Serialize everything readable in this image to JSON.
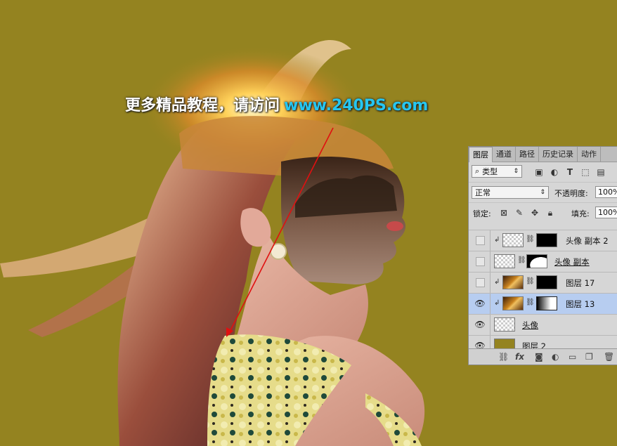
{
  "watermark": {
    "cn": "更多精品教程，请访问",
    "url": "www.240PS.com"
  },
  "panel": {
    "tabs": [
      "图层",
      "通道",
      "路径",
      "历史记录",
      "动作"
    ],
    "filter_label": "类型",
    "blend_mode": "正常",
    "opacity_label": "不透明度:",
    "opacity_value": "100%",
    "lock_label": "锁定:",
    "fill_label": "填充:",
    "fill_value": "100%",
    "layers": [
      {
        "name": "头像 副本 2",
        "visible": false
      },
      {
        "name": "头像 副本",
        "visible": false
      },
      {
        "name": "图层 17",
        "visible": false
      },
      {
        "name": "图层 13",
        "visible": true,
        "selected": true
      },
      {
        "name": "头像",
        "visible": true
      },
      {
        "name": "图层 2",
        "visible": true
      }
    ],
    "footer_icons": [
      "link-icon",
      "fx-icon",
      "mask-icon",
      "adjustment-icon",
      "folder-icon",
      "new-layer-icon",
      "trash-icon"
    ]
  },
  "colors": {
    "background": "#948320",
    "watermark_url": "#26c6f0",
    "arrow": "#e01010",
    "selected_layer": "#b7cdf0"
  }
}
